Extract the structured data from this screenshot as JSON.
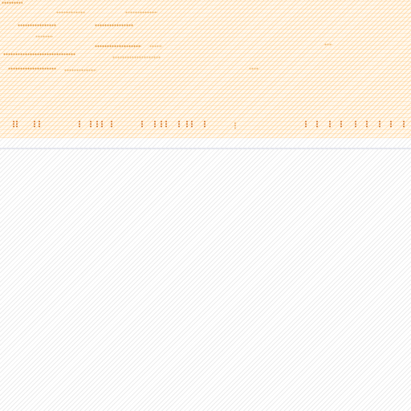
{
  "theme": {
    "accent": "#e49a3c",
    "accent_dark": "#d6782c",
    "accent_light": "#f2bf7a",
    "banner_bg": "#fff9ef",
    "divider": "#e4e6ee",
    "page_bg": "#ffffff"
  },
  "banner": {
    "icon": "noise-texture"
  }
}
